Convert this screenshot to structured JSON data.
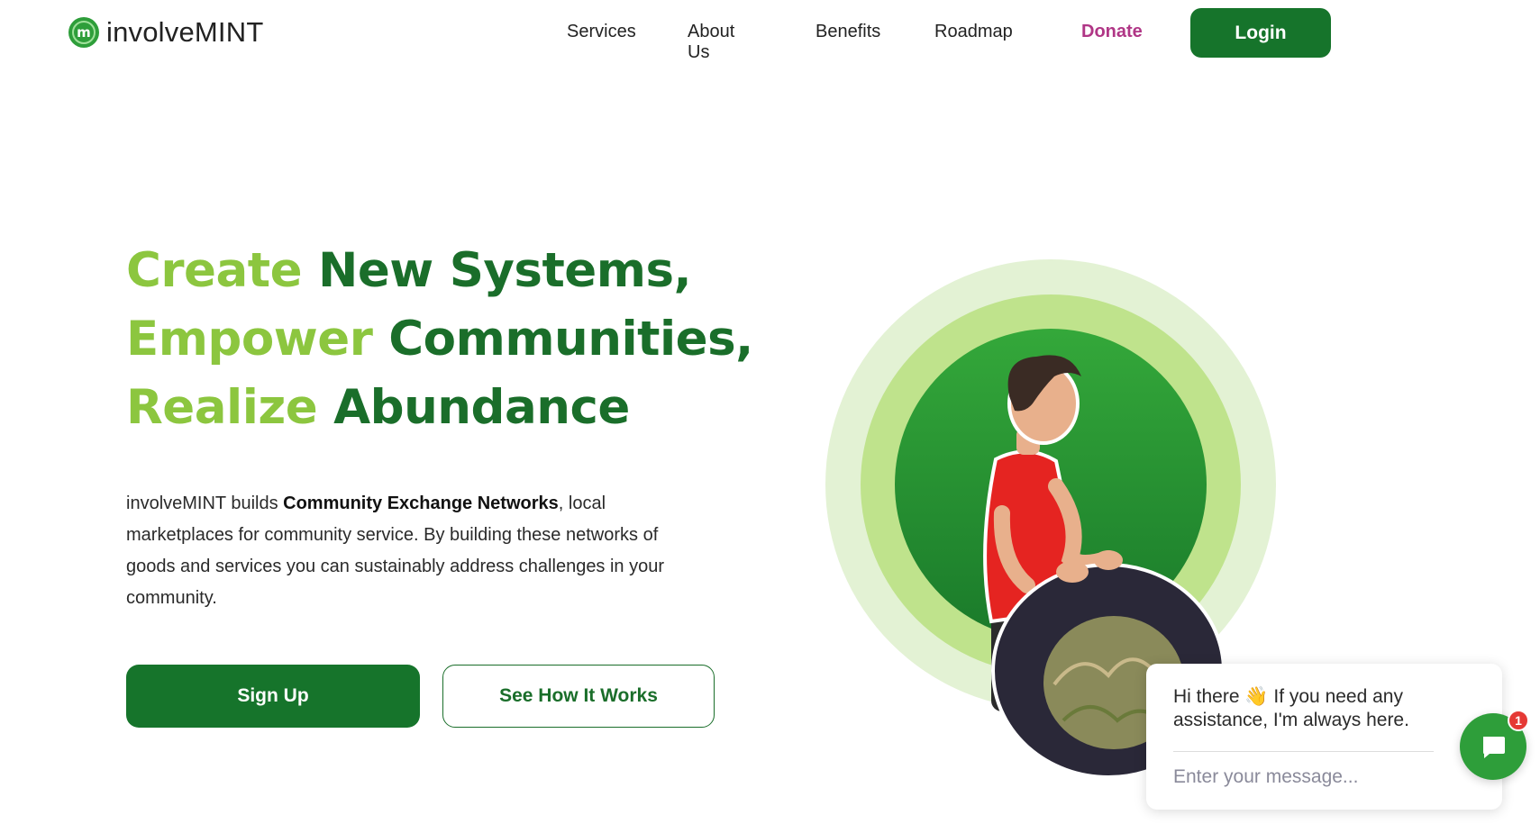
{
  "header": {
    "logo_text": "involveMINT",
    "logo_mark": "m",
    "nav": {
      "services": "Services",
      "about": "About Us",
      "benefits": "Benefits",
      "roadmap": "Roadmap",
      "donate": "Donate"
    },
    "login_label": "Login"
  },
  "hero": {
    "headline": [
      {
        "light": "Create",
        "dark": "New Systems,"
      },
      {
        "light": "Empower",
        "dark": "Communities,"
      },
      {
        "light": "Realize",
        "dark": "Abundance"
      }
    ],
    "description": {
      "before": "involveMINT builds ",
      "bold": "Community Exchange Networks",
      "after": ", local marketplaces for community service. By building these networks of goods and services you can sustainably address challenges in your community."
    },
    "signup_label": "Sign Up",
    "how_it_works_label": "See How It Works",
    "image_name": "boy-rolling-tire-photo"
  },
  "chat": {
    "greeting_before": "Hi there",
    "greeting_emoji": "👋",
    "greeting_after": "If you need any assistance, I'm always here.",
    "input_placeholder": "Enter your message...",
    "unread_count": "1"
  },
  "colors": {
    "brand_green": "#16742b",
    "light_green": "#8cc63f",
    "donate_pink": "#b03686",
    "badge_red": "#e53935"
  }
}
